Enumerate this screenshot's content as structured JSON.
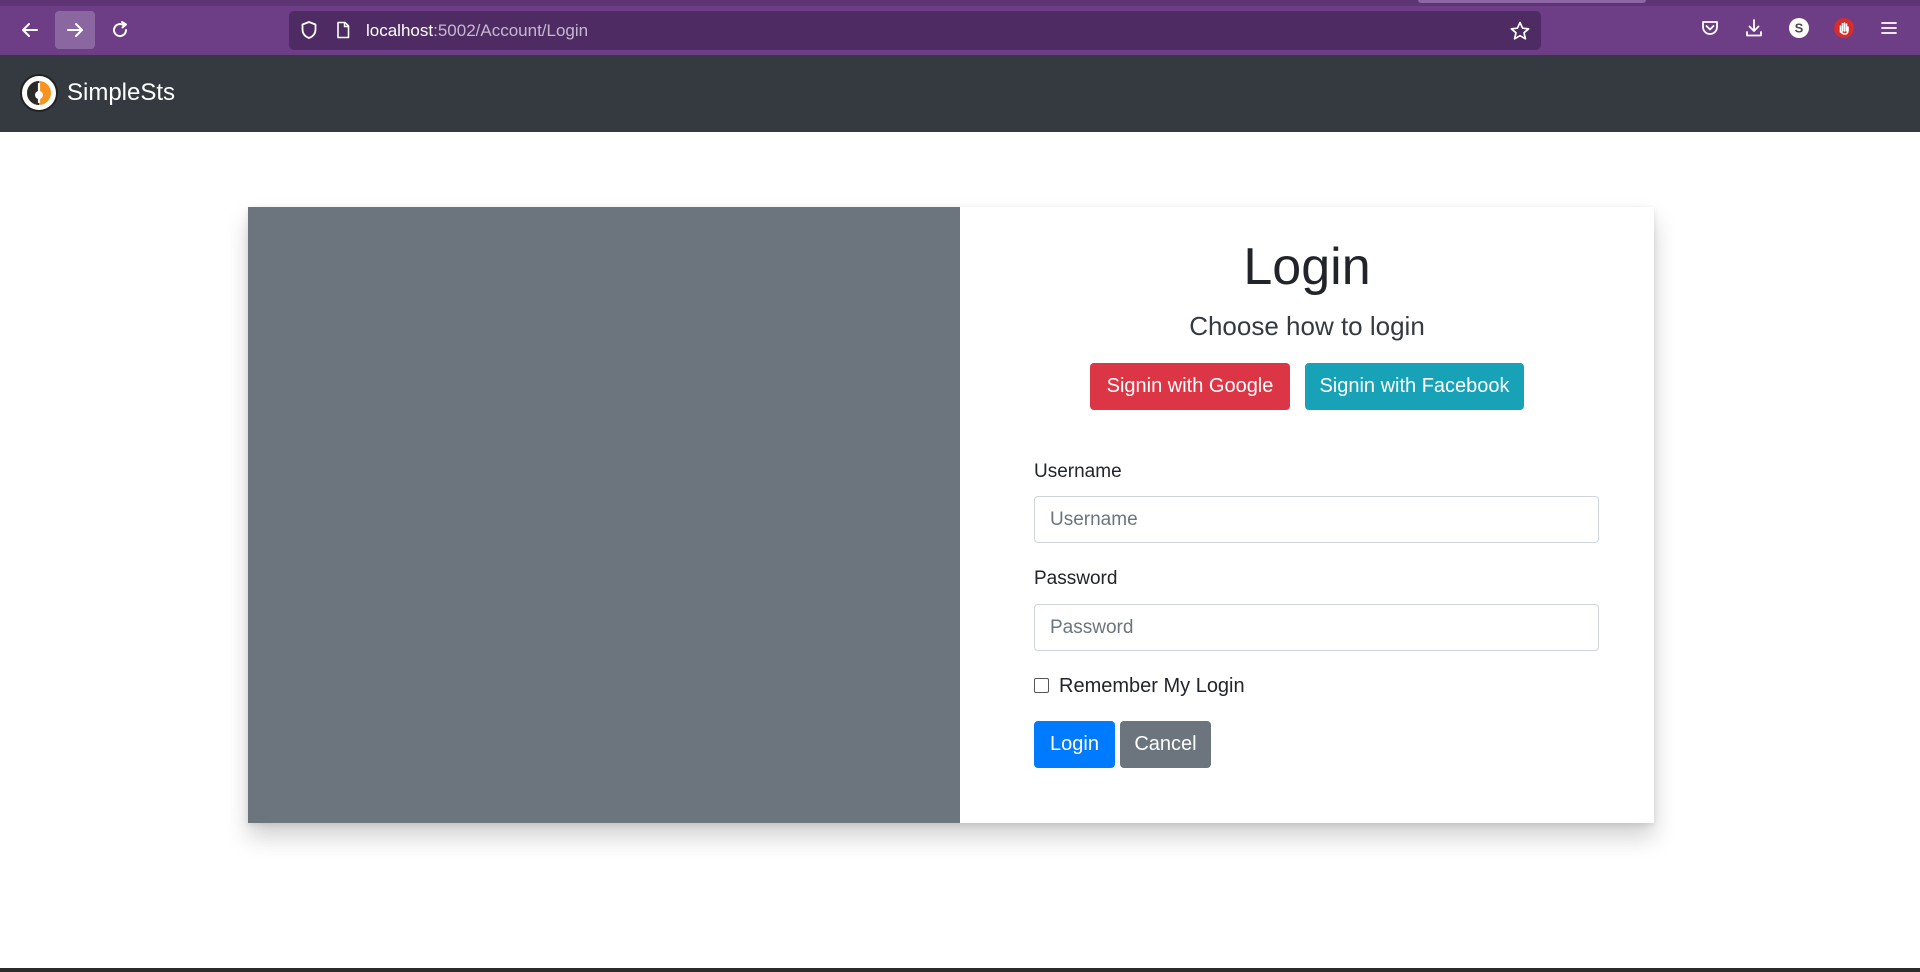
{
  "browser": {
    "url_host": "localhost",
    "url_path": ":5002/Account/Login",
    "profile_initial": "S"
  },
  "navbar": {
    "brand_name": "SimpleSts"
  },
  "login": {
    "title": "Login",
    "subtitle": "Choose how to login",
    "google_button": "Signin with Google",
    "facebook_button": "Signin with Facebook",
    "username_label": "Username",
    "username_placeholder": "Username",
    "username_value": "",
    "password_label": "Password",
    "password_placeholder": "Password",
    "password_value": "",
    "remember_label": "Remember My Login",
    "remember_checked": false,
    "login_button": "Login",
    "cancel_button": "Cancel"
  },
  "colors": {
    "browser_bar": "#6d3e86",
    "navbar": "#343a40",
    "image_panel": "#6c757d",
    "google": "#dc3545",
    "facebook": "#17a2b8",
    "primary": "#007bff",
    "secondary": "#6c757d"
  },
  "icons": {
    "back": "arrow-left-icon",
    "forward": "arrow-right-icon",
    "reload": "reload-icon",
    "tracking": "shield-icon",
    "page": "page-icon",
    "bookmark": "star-icon",
    "pocket": "pocket-icon",
    "downloads": "download-icon",
    "account": "account-icon",
    "extension": "hand-stop-icon",
    "menu": "hamburger-menu-icon"
  }
}
